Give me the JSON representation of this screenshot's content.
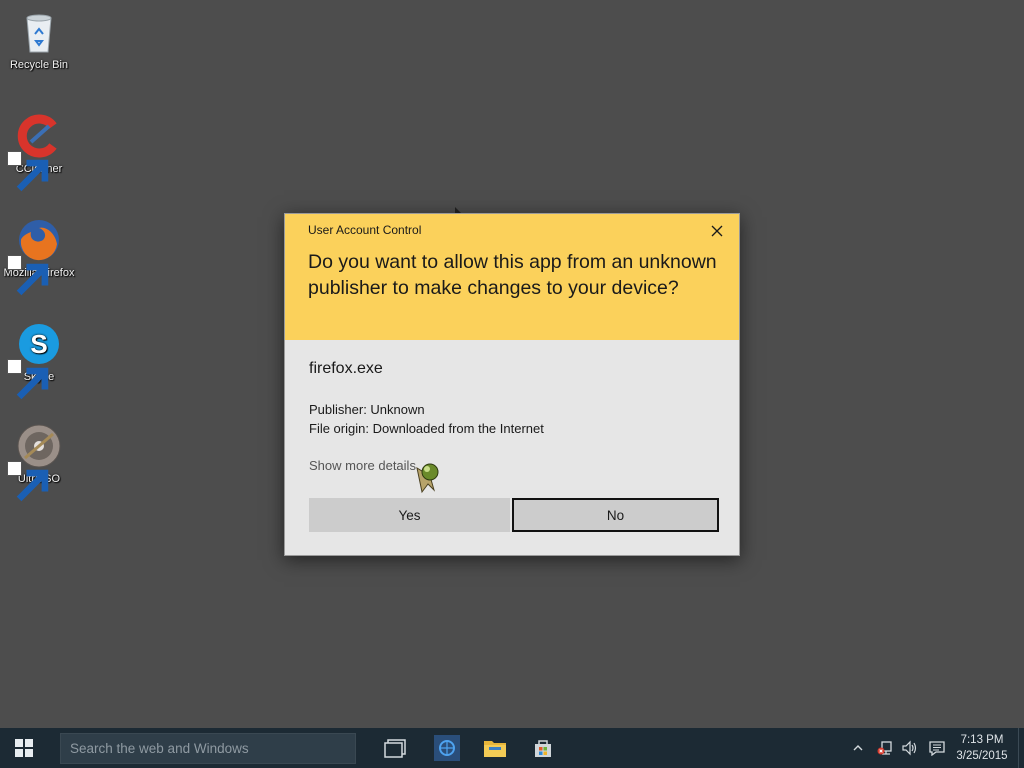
{
  "desktop": {
    "icons": [
      {
        "label": "Recycle Bin",
        "icon": "recycle-bin-icon",
        "shortcut": false
      },
      {
        "label": "CCleaner",
        "icon": "ccleaner-icon",
        "shortcut": true
      },
      {
        "label": "Mozilla Firefox",
        "icon": "firefox-icon",
        "shortcut": true
      },
      {
        "label": "Skype",
        "icon": "skype-icon",
        "shortcut": true
      },
      {
        "label": "UltraISO",
        "icon": "ultraiso-icon",
        "shortcut": true
      }
    ]
  },
  "uac": {
    "title": "User Account Control",
    "question": "Do you want to allow this app from an unknown publisher to make changes to your device?",
    "app_name": "firefox.exe",
    "publisher": "Publisher: Unknown",
    "origin": "File origin: Downloaded from the Internet",
    "more_details": "Show more details",
    "yes_label": "Yes",
    "no_label": "No",
    "colors": {
      "header": "#fbd15b",
      "body": "#e6e6e6",
      "button": "#cccccc"
    }
  },
  "taskbar": {
    "search_placeholder": "Search the web and Windows",
    "pinned": [
      "task-view-icon",
      "edge-icon",
      "file-explorer-icon",
      "store-icon"
    ],
    "tray": [
      "chevron-up-icon",
      "network-icon",
      "volume-icon",
      "action-center-icon"
    ],
    "clock_time": "7:13 PM",
    "clock_date": "3/25/2015",
    "color": "#1c2a34"
  }
}
